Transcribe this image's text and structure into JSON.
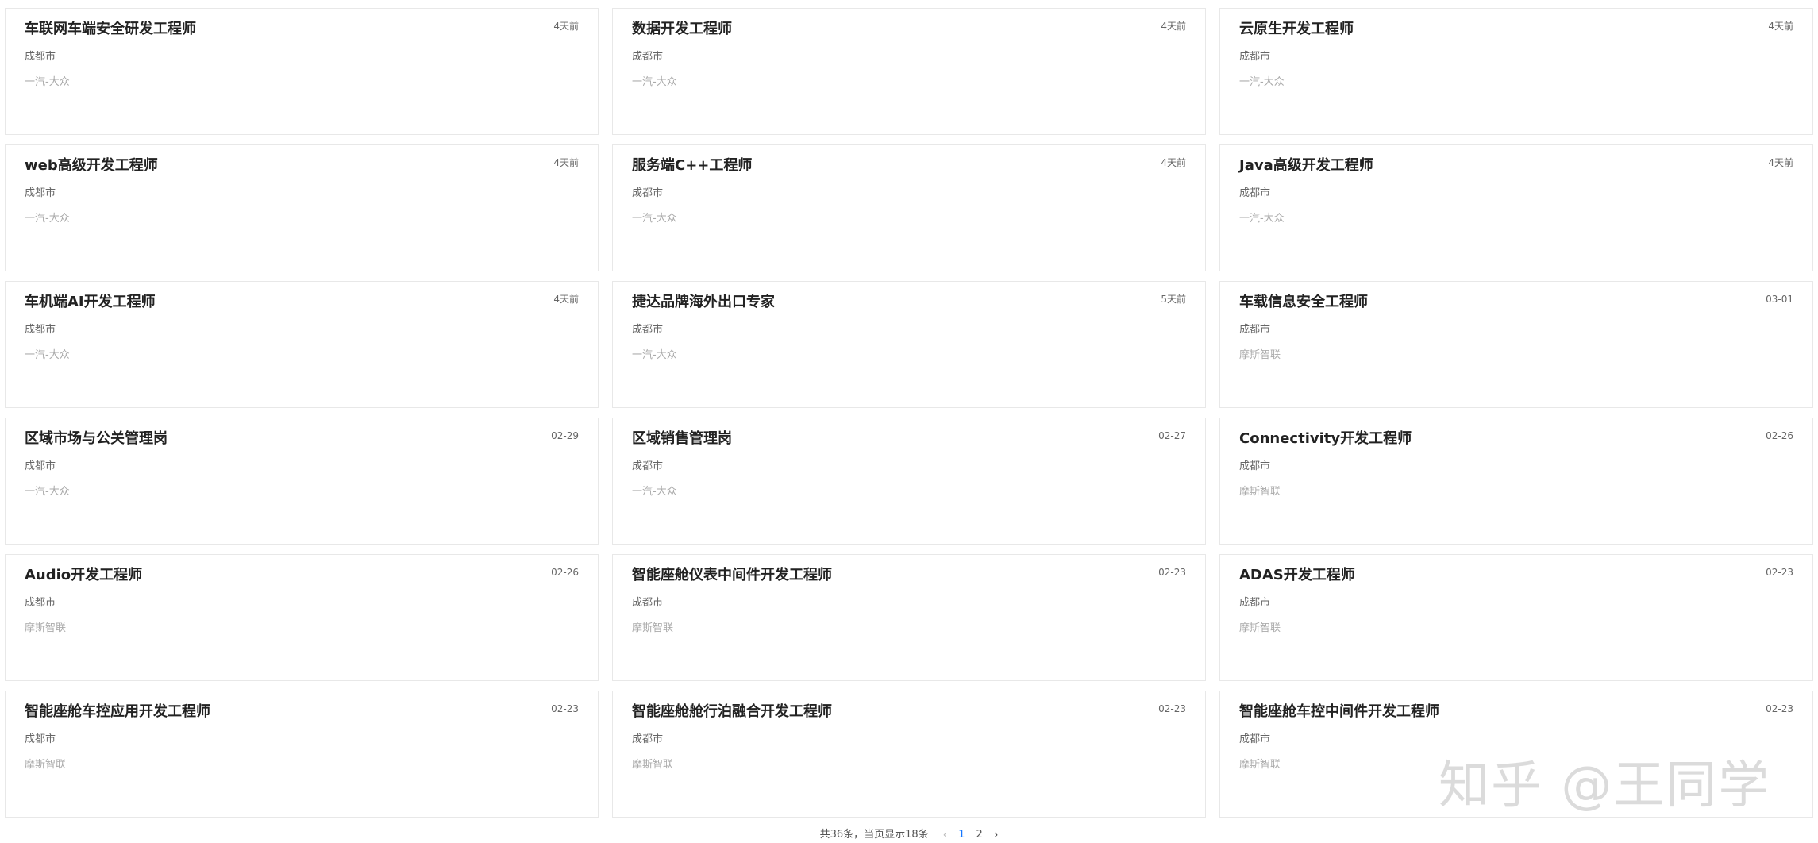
{
  "jobs": [
    {
      "title": "车联网车端安全研发工程师",
      "date": "4天前",
      "city": "成都市",
      "company": "一汽-大众"
    },
    {
      "title": "数据开发工程师",
      "date": "4天前",
      "city": "成都市",
      "company": "一汽-大众"
    },
    {
      "title": "云原生开发工程师",
      "date": "4天前",
      "city": "成都市",
      "company": "一汽-大众"
    },
    {
      "title": "web高级开发工程师",
      "date": "4天前",
      "city": "成都市",
      "company": "一汽-大众"
    },
    {
      "title": "服务端C++工程师",
      "date": "4天前",
      "city": "成都市",
      "company": "一汽-大众"
    },
    {
      "title": "Java高级开发工程师",
      "date": "4天前",
      "city": "成都市",
      "company": "一汽-大众"
    },
    {
      "title": "车机端AI开发工程师",
      "date": "4天前",
      "city": "成都市",
      "company": "一汽-大众"
    },
    {
      "title": "捷达品牌海外出口专家",
      "date": "5天前",
      "city": "成都市",
      "company": "一汽-大众"
    },
    {
      "title": "车载信息安全工程师",
      "date": "03-01",
      "city": "成都市",
      "company": "摩斯智联"
    },
    {
      "title": "区域市场与公关管理岗",
      "date": "02-29",
      "city": "成都市",
      "company": "一汽-大众"
    },
    {
      "title": "区域销售管理岗",
      "date": "02-27",
      "city": "成都市",
      "company": "一汽-大众"
    },
    {
      "title": "Connectivity开发工程师",
      "date": "02-26",
      "city": "成都市",
      "company": "摩斯智联"
    },
    {
      "title": "Audio开发工程师",
      "date": "02-26",
      "city": "成都市",
      "company": "摩斯智联"
    },
    {
      "title": "智能座舱仪表中间件开发工程师",
      "date": "02-23",
      "city": "成都市",
      "company": "摩斯智联"
    },
    {
      "title": "ADAS开发工程师",
      "date": "02-23",
      "city": "成都市",
      "company": "摩斯智联"
    },
    {
      "title": "智能座舱车控应用开发工程师",
      "date": "02-23",
      "city": "成都市",
      "company": "摩斯智联"
    },
    {
      "title": "智能座舱舱行泊融合开发工程师",
      "date": "02-23",
      "city": "成都市",
      "company": "摩斯智联"
    },
    {
      "title": "智能座舱车控中间件开发工程师",
      "date": "02-23",
      "city": "成都市",
      "company": "摩斯智联"
    }
  ],
  "pagination": {
    "summary": "共36条，当页显示18条",
    "prev_icon": "‹",
    "pages": [
      "1",
      "2"
    ],
    "current_page": "1",
    "next_icon": "›"
  },
  "watermark": "知乎 @王同学",
  "colors": {
    "accent": "#1677ff",
    "title": "#222222",
    "meta": "#666666",
    "company": "#aaaaaa",
    "border": "#e8e8e8"
  }
}
